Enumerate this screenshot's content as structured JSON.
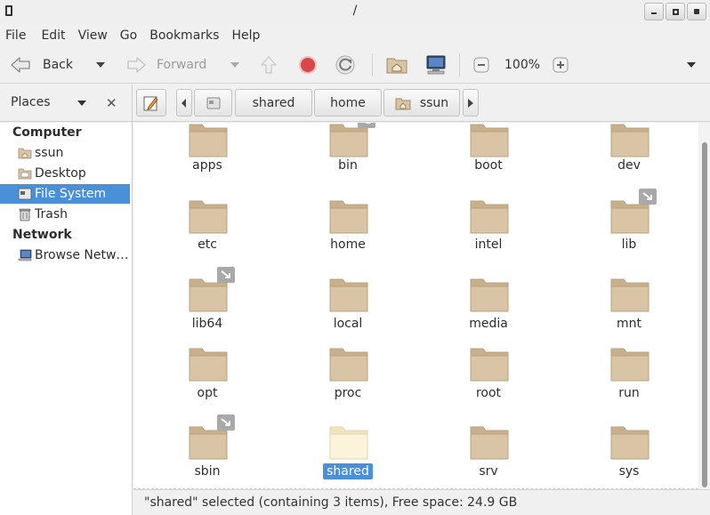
{
  "window": {
    "title": "/"
  },
  "menubar": {
    "items": [
      "File",
      "Edit",
      "View",
      "Go",
      "Bookmarks",
      "Help"
    ]
  },
  "toolbar": {
    "back_label": "Back",
    "forward_label": "Forward",
    "zoom_level": "100%"
  },
  "location": {
    "places_label": "Places",
    "breadcrumbs": [
      "shared",
      "home",
      "ssun"
    ]
  },
  "sidebar": {
    "sections": [
      {
        "title": "Computer",
        "items": [
          {
            "label": "ssun",
            "icon": "home-folder-icon"
          },
          {
            "label": "Desktop",
            "icon": "desktop-folder-icon"
          },
          {
            "label": "File System",
            "icon": "drive-icon",
            "selected": true
          },
          {
            "label": "Trash",
            "icon": "trash-icon"
          }
        ]
      },
      {
        "title": "Network",
        "items": [
          {
            "label": "Browse Netw…",
            "icon": "network-icon"
          }
        ]
      }
    ]
  },
  "files": [
    {
      "name": "apps"
    },
    {
      "name": "bin",
      "link": true
    },
    {
      "name": "boot"
    },
    {
      "name": "dev"
    },
    {
      "name": "etc"
    },
    {
      "name": "home"
    },
    {
      "name": "intel"
    },
    {
      "name": "lib",
      "link": true
    },
    {
      "name": "lib64",
      "link": true
    },
    {
      "name": "local"
    },
    {
      "name": "media"
    },
    {
      "name": "mnt"
    },
    {
      "name": "opt"
    },
    {
      "name": "proc"
    },
    {
      "name": "root"
    },
    {
      "name": "run"
    },
    {
      "name": "sbin",
      "link": true
    },
    {
      "name": "shared",
      "selected": true
    },
    {
      "name": "srv"
    },
    {
      "name": "sys"
    }
  ],
  "status": {
    "text": "\"shared\" selected (containing 3 items), Free space: 24.9 GB"
  },
  "colors": {
    "selection": "#4a90d9",
    "folder": "#d9c4a6",
    "folder_selected": "#fbf3da"
  }
}
